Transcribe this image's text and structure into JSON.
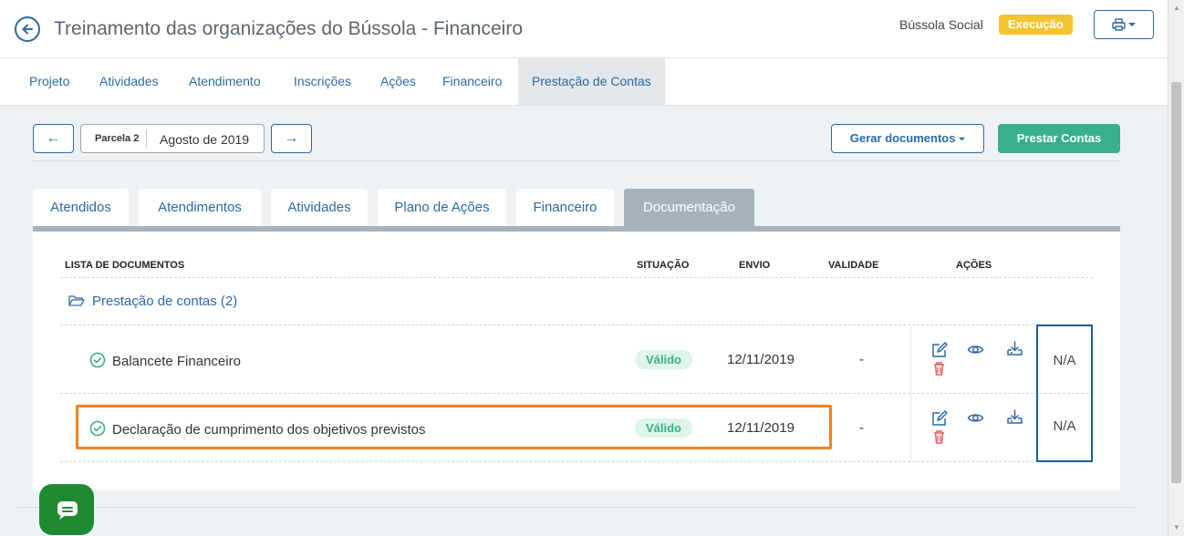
{
  "header": {
    "title": "Treinamento das organizações do Bússola - Financeiro",
    "org_name": "Bússola Social",
    "status_badge": "Execução"
  },
  "nav": {
    "items": [
      "Projeto",
      "Atividades",
      "Atendimento",
      "Inscrições",
      "Ações",
      "Financeiro",
      "Prestação de Contas"
    ],
    "active": "Prestação de Contas"
  },
  "period": {
    "parcela_label": "Parcela 2",
    "period_value": "Agosto de 2019",
    "prev_arrow": "←",
    "next_arrow": "→"
  },
  "toolbar": {
    "gerar_label": "Gerar documentos",
    "prestar_label": "Prestar Contas"
  },
  "subtabs": {
    "items": [
      "Atendidos",
      "Atendimentos",
      "Atividades",
      "Plano de Ações",
      "Financeiro",
      "Documentação"
    ],
    "active": "Documentação"
  },
  "table": {
    "headers": {
      "list": "LISTA DE DOCUMENTOS",
      "status": "SITUAÇÃO",
      "sent": "ENVIO",
      "validity": "VALIDADE",
      "actions": "AÇÕES"
    },
    "folder": "Prestação de contas (2)",
    "rows": [
      {
        "name": "Balancete Financeiro",
        "status": "Válido",
        "sent": "12/11/2019",
        "validity": "-",
        "extra": "N/A"
      },
      {
        "name": "Declaração de cumprimento dos objetivos previstos",
        "status": "Válido",
        "sent": "12/11/2019",
        "validity": "-",
        "extra": "N/A"
      }
    ]
  },
  "colors": {
    "primary": "#2d6aa3",
    "success": "#37b08c",
    "warning": "#f4c430",
    "danger": "#e05a5a",
    "highlight": "#f08225",
    "chat": "#1f8a33"
  },
  "icons": [
    "back-arrow-icon",
    "printer-icon",
    "folder-open-icon",
    "check-circle-icon",
    "edit-icon",
    "eye-icon",
    "download-icon",
    "trash-icon",
    "chat-icon"
  ]
}
